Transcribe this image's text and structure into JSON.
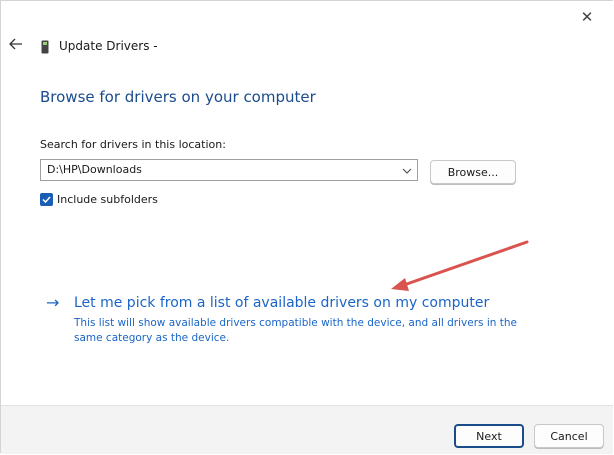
{
  "window": {
    "title": "Update Drivers -",
    "close_icon": "close-icon",
    "back_icon": "back-arrow-icon",
    "device_icon": "device-icon"
  },
  "page": {
    "heading": "Browse for drivers on your computer",
    "search_label": "Search for drivers in this location:",
    "path_value": "D:\\HP\\Downloads",
    "browse_label": "Browse...",
    "include_subfolders_label": "Include subfolders",
    "include_subfolders_checked": true
  },
  "pick_option": {
    "arrow": "→",
    "title": "Let me pick from a list of available drivers on my computer",
    "description": "This list will show available drivers compatible with the device, and all drivers in the same category as the device."
  },
  "footer": {
    "next_label": "Next",
    "cancel_label": "Cancel"
  },
  "colors": {
    "heading": "#1a4c8c",
    "link": "#1a65c7",
    "checkbox": "#1a5fb4",
    "annotation_arrow": "#d9534f",
    "footer_bg": "#f3f3f3"
  }
}
